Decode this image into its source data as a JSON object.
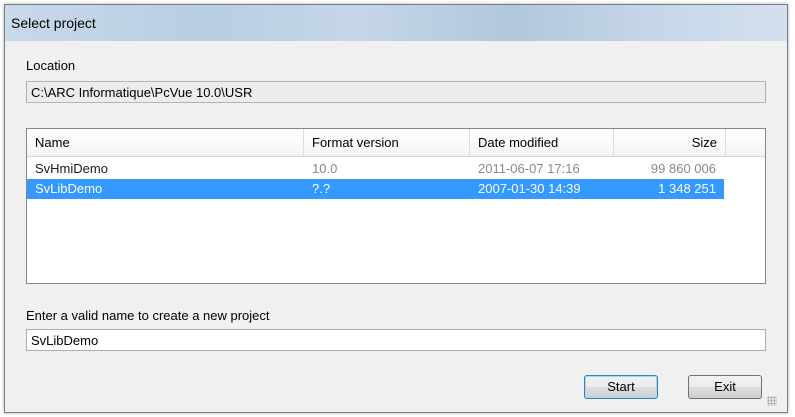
{
  "window": {
    "title": "Select project"
  },
  "location": {
    "label": "Location",
    "path": "C:\\ARC Informatique\\PcVue 10.0\\USR"
  },
  "projects": {
    "columns": [
      "Name",
      "Format version",
      "Date modified",
      "Size"
    ],
    "rows": [
      {
        "name": "SvHmiDemo",
        "format": "10.0",
        "date": "2011-06-07  17:16",
        "size": "99 860 006",
        "selected": false
      },
      {
        "name": "SvLibDemo",
        "format": "?.?",
        "date": "2007-01-30  14:39",
        "size": "1 348 251",
        "selected": true
      }
    ]
  },
  "new_project": {
    "label": "Enter a valid name to create a new project",
    "value": "SvLibDemo"
  },
  "buttons": {
    "start": "Start",
    "exit": "Exit"
  },
  "colors": {
    "selection": "#3399ff",
    "title_bar": "#c5d6e8"
  }
}
